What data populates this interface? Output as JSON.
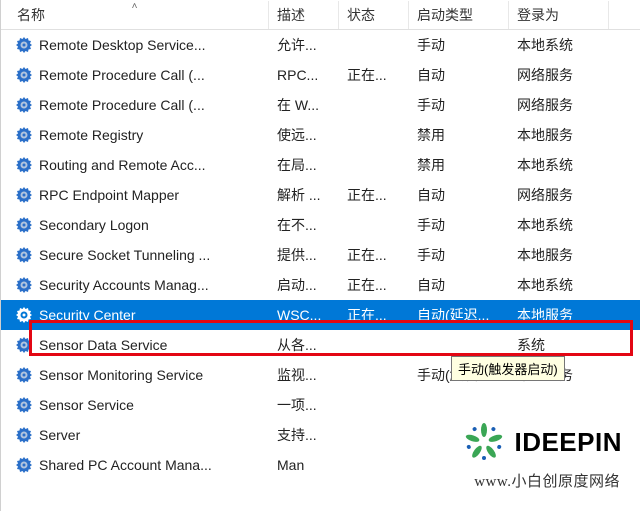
{
  "header": {
    "name": "名称",
    "desc": "描述",
    "status": "状态",
    "startup": "启动类型",
    "login": "登录为"
  },
  "rows": [
    {
      "name": "Remote Desktop Service...",
      "desc": "允许...",
      "status": "",
      "startup": "手动",
      "login": "本地系统",
      "selected": false
    },
    {
      "name": "Remote Procedure Call (...",
      "desc": "RPC...",
      "status": "正在...",
      "startup": "自动",
      "login": "网络服务",
      "selected": false
    },
    {
      "name": "Remote Procedure Call (...",
      "desc": "在 W...",
      "status": "",
      "startup": "手动",
      "login": "网络服务",
      "selected": false
    },
    {
      "name": "Remote Registry",
      "desc": "使远...",
      "status": "",
      "startup": "禁用",
      "login": "本地服务",
      "selected": false
    },
    {
      "name": "Routing and Remote Acc...",
      "desc": "在局...",
      "status": "",
      "startup": "禁用",
      "login": "本地系统",
      "selected": false
    },
    {
      "name": "RPC Endpoint Mapper",
      "desc": "解析 ...",
      "status": "正在...",
      "startup": "自动",
      "login": "网络服务",
      "selected": false
    },
    {
      "name": "Secondary Logon",
      "desc": "在不...",
      "status": "",
      "startup": "手动",
      "login": "本地系统",
      "selected": false
    },
    {
      "name": "Secure Socket Tunneling ...",
      "desc": "提供...",
      "status": "正在...",
      "startup": "手动",
      "login": "本地服务",
      "selected": false
    },
    {
      "name": "Security Accounts Manag...",
      "desc": "启动...",
      "status": "正在...",
      "startup": "自动",
      "login": "本地系统",
      "selected": false
    },
    {
      "name": "Security Center",
      "desc": "WSC...",
      "status": "正在...",
      "startup": "自动(延迟...",
      "login": "本地服务",
      "selected": true
    },
    {
      "name": "Sensor Data Service",
      "desc": "从各...",
      "status": "",
      "startup": "",
      "login": "系统",
      "selected": false
    },
    {
      "name": "Sensor Monitoring Service",
      "desc": "监视...",
      "status": "",
      "startup": "手动(触发...",
      "login": "本地服务",
      "selected": false
    },
    {
      "name": "Sensor Service",
      "desc": "一项...",
      "status": "",
      "startup": "",
      "login": "",
      "selected": false
    },
    {
      "name": "Server",
      "desc": "支持...",
      "status": "",
      "startup": "",
      "login": "",
      "selected": false
    },
    {
      "name": "Shared PC Account Mana...",
      "desc": "Man",
      "status": "",
      "startup": "",
      "login": "",
      "selected": false
    }
  ],
  "tooltip": "手动(触发器启动)",
  "watermark": {
    "brand": "IDEEPIN",
    "site": "www.小白创原度网络"
  },
  "icons": {
    "gear_fill": "#2a6fc9",
    "gear_hub": "#b0c4de"
  }
}
